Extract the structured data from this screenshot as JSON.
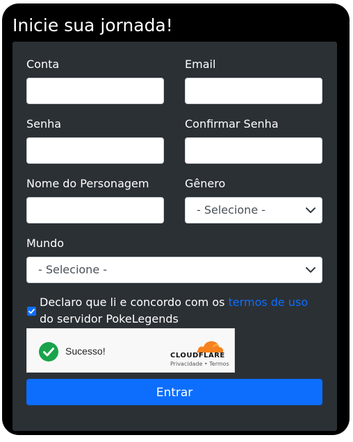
{
  "page": {
    "title": "Inicie sua jornada!"
  },
  "form": {
    "fields": {
      "account": {
        "label": "Conta",
        "value": "",
        "placeholder": ""
      },
      "email": {
        "label": "Email",
        "value": "",
        "placeholder": ""
      },
      "password": {
        "label": "Senha",
        "value": "",
        "placeholder": ""
      },
      "confirm_password": {
        "label": "Confirmar Senha",
        "value": "",
        "placeholder": ""
      },
      "character_name": {
        "label": "Nome do Personagem",
        "value": "",
        "placeholder": ""
      },
      "gender": {
        "label": "Gênero",
        "selected": "- Selecione -"
      },
      "world": {
        "label": "Mundo",
        "selected": "- Selecione -"
      }
    },
    "terms": {
      "checked": true,
      "text_before": "Declaro que li e concordo com os ",
      "link_text": "termos de uso",
      "text_after": " do servidor PokeLegends"
    },
    "captcha": {
      "status": "Sucesso!",
      "brand": "CLOUDFLARE",
      "privacy_link": "Privacidade",
      "separator": "•",
      "terms_link": "Termos"
    },
    "submit_label": "Entrar"
  },
  "colors": {
    "frame": "#000000",
    "panel": "#2b3035",
    "accent": "#0d6efd",
    "success": "#1aa34a",
    "cloudflare_orange": "#f6821f"
  }
}
